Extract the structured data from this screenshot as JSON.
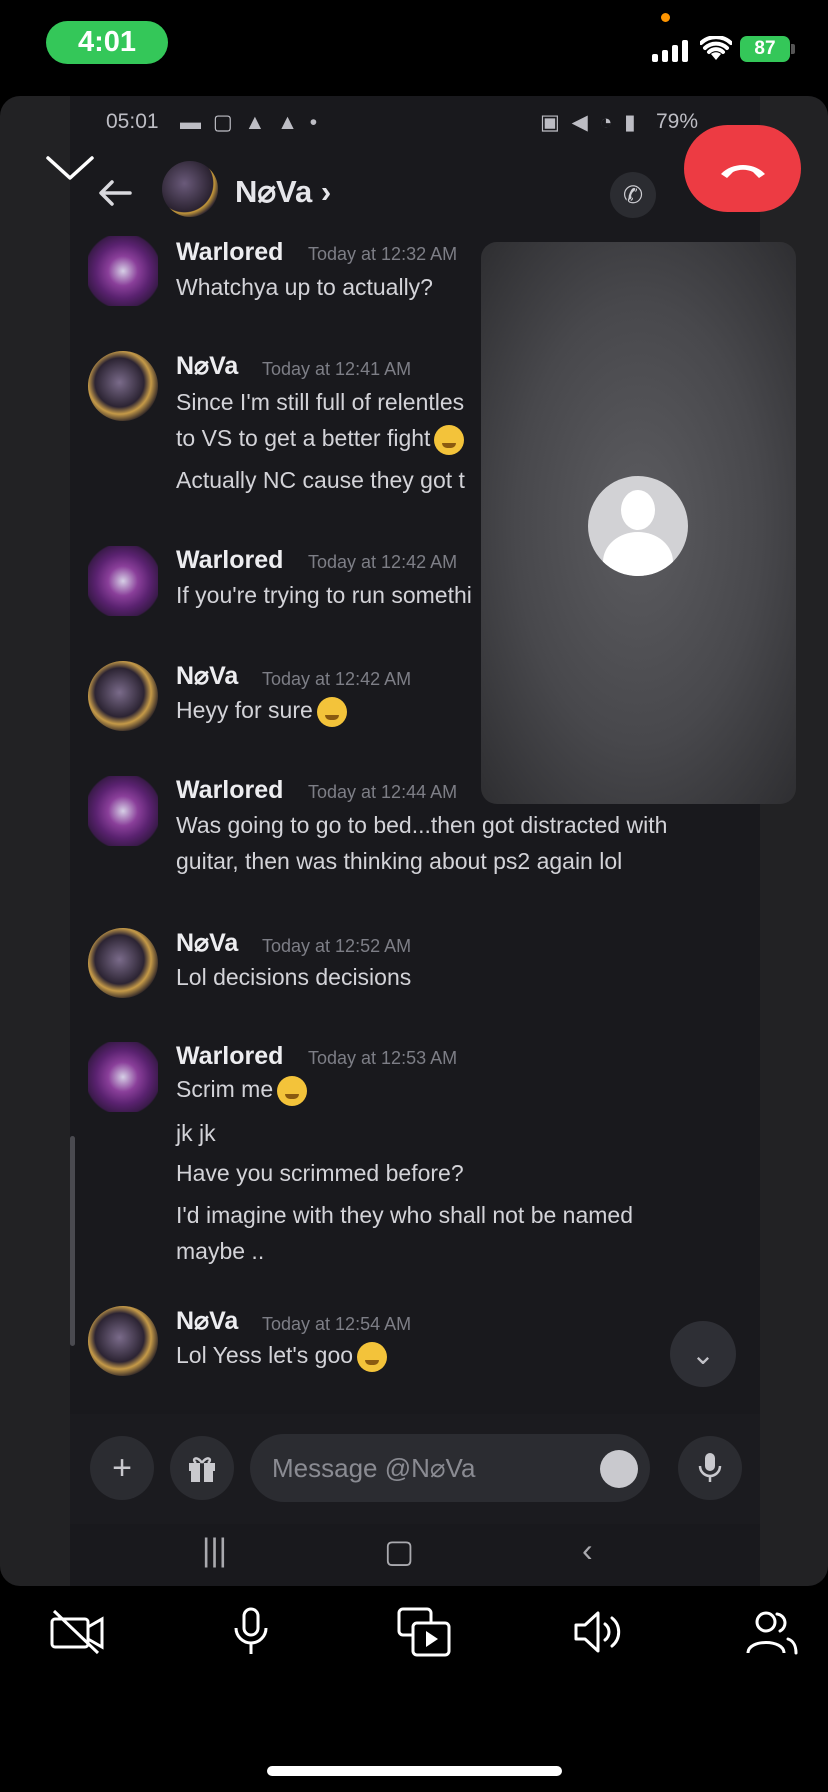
{
  "ios_status": {
    "time": "4:01",
    "battery": "87"
  },
  "shared_screen": {
    "android_status": {
      "time": "05:01",
      "battery": "79%"
    },
    "header": {
      "contact_name": "N⌀Va ›"
    },
    "messages": [
      {
        "author": "Warlored",
        "avatar": "warlored-avatar",
        "timestamp": "Today at 12:32 AM",
        "lines": [
          "Whatchya up to actually?"
        ]
      },
      {
        "author": "N⌀Va",
        "avatar": "nova-avatar",
        "timestamp": "Today at 12:41 AM",
        "lines": [
          "Since I'm still full of relentles",
          "to VS to get a better fight",
          "Actually NC cause they got t"
        ]
      },
      {
        "author": "Warlored",
        "avatar": "warlored-avatar",
        "timestamp": "Today at 12:42 AM",
        "lines": [
          "If you're trying to run somethi"
        ]
      },
      {
        "author": "N⌀Va",
        "avatar": "nova-avatar",
        "timestamp": "Today at 12:42 AM",
        "lines": [
          "Heyy for sure"
        ]
      },
      {
        "author": "Warlored",
        "avatar": "warlored-avatar",
        "timestamp": "Today at 12:44 AM",
        "lines": [
          "Was going to go to bed...then got distracted with",
          "guitar, then was thinking about ps2 again lol"
        ]
      },
      {
        "author": "N⌀Va",
        "avatar": "nova-avatar",
        "timestamp": "Today at 12:52 AM",
        "lines": [
          "Lol decisions decisions"
        ]
      },
      {
        "author": "Warlored",
        "avatar": "warlored-avatar",
        "timestamp": "Today at 12:53 AM",
        "lines": [
          "Scrim me",
          "jk jk",
          "Have you scrimmed before?",
          "I'd imagine with they who shall not be named",
          "maybe .."
        ]
      },
      {
        "author": "N⌀Va",
        "avatar": "nova-avatar",
        "timestamp": "Today at 12:54 AM",
        "lines": [
          "Lol Yess let's goo"
        ]
      }
    ],
    "composer": {
      "placeholder": "Message @N⌀Va"
    }
  },
  "icons": {
    "minimize": "chevron-down-icon",
    "end_call": "hang-up-icon",
    "camera_off": "camera-off-icon",
    "microphone": "microphone-icon",
    "screen_share": "screen-share-icon",
    "speaker": "speaker-icon",
    "participants": "participants-icon"
  },
  "colors": {
    "status_pill": "#34c759",
    "end_call": "#ed3b43",
    "chat_bg": "#19191d"
  }
}
